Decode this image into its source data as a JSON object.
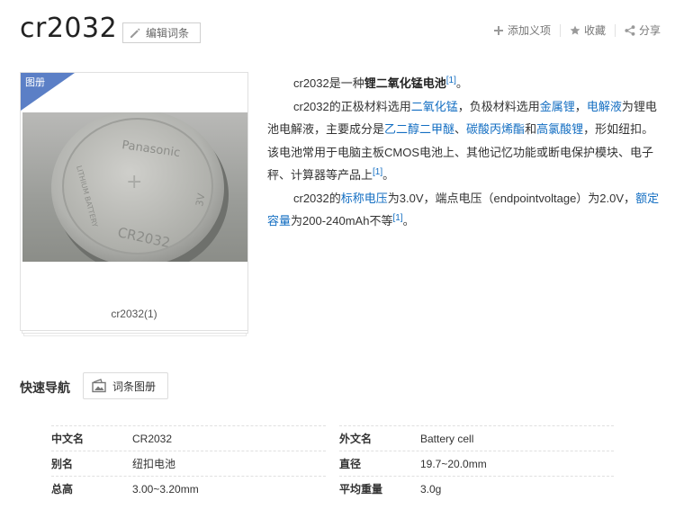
{
  "header": {
    "title": "cr2032",
    "edit_label": "编辑词条",
    "actions": {
      "add_meaning": "添加义项",
      "favorite": "收藏",
      "share": "分享"
    }
  },
  "album": {
    "tag": "图册",
    "caption": "cr2032(1)",
    "photo_text": {
      "brand": "Panasonic",
      "side": "LITHIUM BATTERY",
      "model": "CR2032",
      "volt": "3V",
      "edge": "+"
    }
  },
  "summary": {
    "p1": {
      "t1": "cr2032是一种",
      "bold": "锂二氧化锰电池",
      "ref": "[1]",
      "t2": "。"
    },
    "p2": {
      "t1": "cr2032的正极材料选用",
      "link1": "二氧化锰",
      "t2": "，负极材料选用",
      "link2": "金属锂",
      "t3": "，",
      "link3": "电解液",
      "t4": "为锂电池电解液，主要成分是",
      "link4": "乙二醇二甲醚",
      "t5": "、",
      "link5": "碳酸丙烯酯",
      "t6": "和",
      "link6": "高氯酸锂",
      "t7": "，形如纽扣。该电池常用于电脑主板CMOS电池上、其他记忆功能或断电保护模块、电子秤、计算器等产品上",
      "ref": "[1]",
      "t8": "。"
    },
    "p3": {
      "t1": "cr2032的",
      "link1": "标称电压",
      "t2": "为3.0V，端点电压（endpointvoltage）为2.0V，",
      "link2": "额定容量",
      "t3": "为200-240mAh不等",
      "ref": "[1]",
      "t4": "。"
    }
  },
  "quicknav": {
    "label": "快速导航",
    "button": "词条图册"
  },
  "basic_info": {
    "left": [
      {
        "key": "中文名",
        "value": "CR2032"
      },
      {
        "key": "别名",
        "value": "纽扣电池"
      },
      {
        "key": "总高",
        "value": "3.00~3.20mm"
      }
    ],
    "right": [
      {
        "key": "外文名",
        "value": "Battery cell"
      },
      {
        "key": "直径",
        "value": "19.7~20.0mm"
      },
      {
        "key": "平均重量",
        "value": "3.0g"
      }
    ]
  },
  "colors": {
    "link": "#136ec2",
    "album_tag": "#5b7fc6"
  }
}
